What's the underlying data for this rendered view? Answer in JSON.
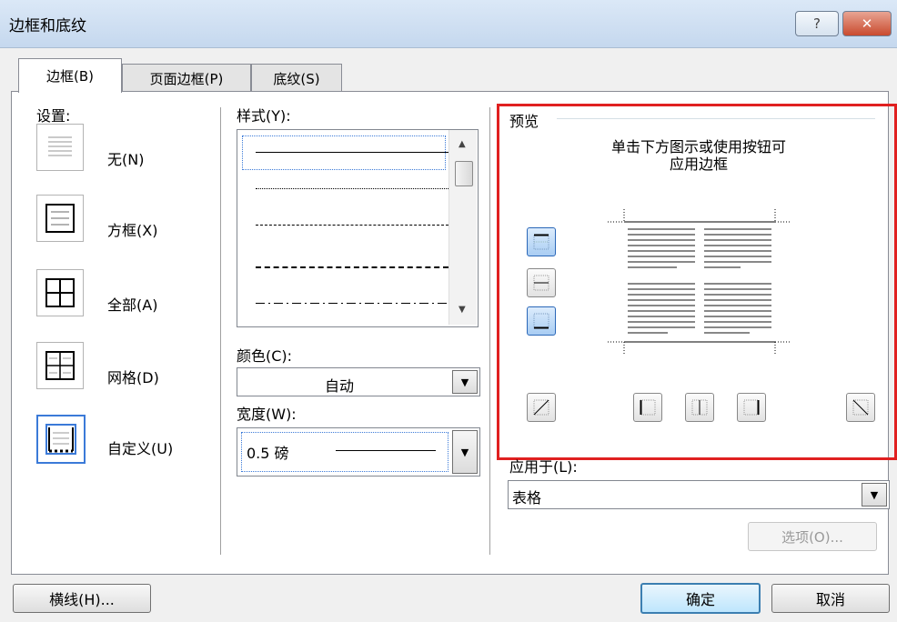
{
  "window": {
    "title": "边框和底纹",
    "help_label": "?",
    "close_label": "✕"
  },
  "tabs": [
    {
      "label": "边框(B)",
      "active": true
    },
    {
      "label": "页面边框(P)",
      "active": false
    },
    {
      "label": "底纹(S)",
      "active": false
    }
  ],
  "settings": {
    "header": "设置:",
    "options": [
      {
        "label": "无(N)",
        "icon": "none-border-icon"
      },
      {
        "label": "方框(X)",
        "icon": "box-border-icon"
      },
      {
        "label": "全部(A)",
        "icon": "all-border-icon"
      },
      {
        "label": "网格(D)",
        "icon": "grid-border-icon"
      },
      {
        "label": "自定义(U)",
        "icon": "custom-border-icon",
        "selected": true
      }
    ]
  },
  "style": {
    "header": "样式(Y):"
  },
  "color": {
    "label": "颜色(C):",
    "value": "自动"
  },
  "width": {
    "label": "宽度(W):",
    "value": "0.5 磅"
  },
  "preview": {
    "header": "预览",
    "instruction_line1": "单击下方图示或使用按钮可",
    "instruction_line2": "应用边框"
  },
  "apply_to": {
    "label": "应用于(L):",
    "value": "表格"
  },
  "buttons": {
    "options": "选项(O)...",
    "horizontal_line": "横线(H)...",
    "ok": "确定",
    "cancel": "取消"
  }
}
